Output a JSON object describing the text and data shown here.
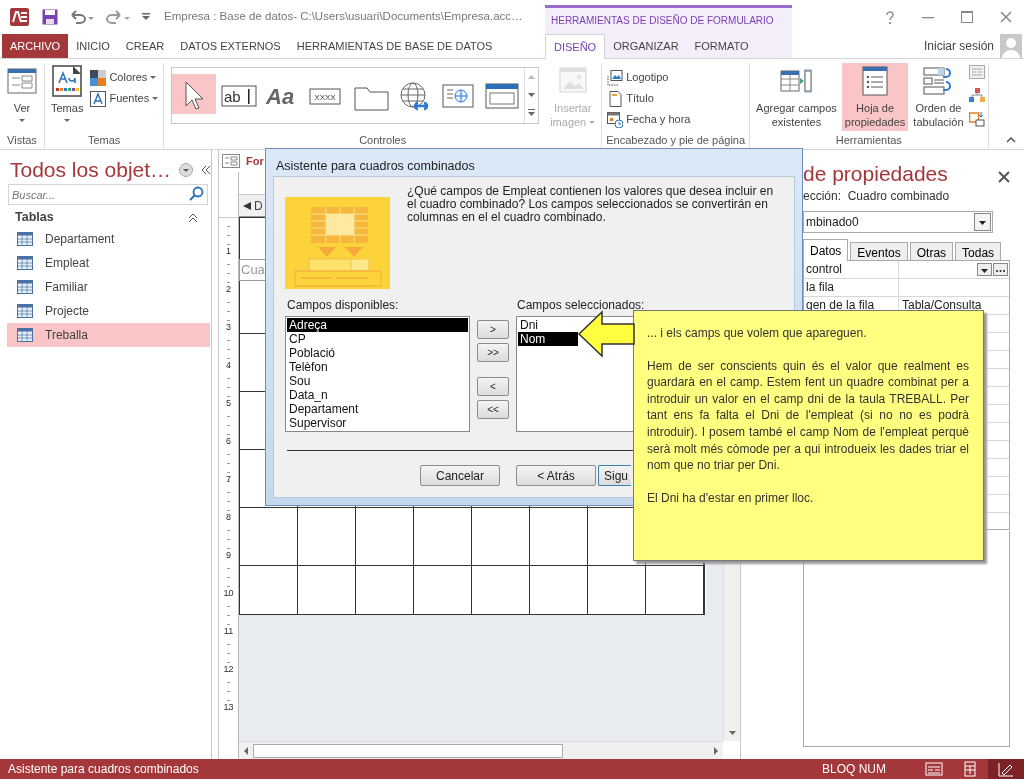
{
  "title_bar": {
    "title": "Empresa : Base de datos- C:\\Users\\usuari\\Documents\\Empresa.acc…",
    "context_tab": "HERRAMIENTAS DE DISEÑO DE FORMULARIO",
    "sign_in": "Iniciar sesión"
  },
  "ribbon_tabs": [
    {
      "label": "ARCHIVO",
      "kind": "file",
      "selected": false
    },
    {
      "label": "INICIO",
      "kind": "tab",
      "selected": false
    },
    {
      "label": "CREAR",
      "kind": "tab",
      "selected": false
    },
    {
      "label": "DATOS EXTERNOS",
      "kind": "tab",
      "selected": false
    },
    {
      "label": "HERRAMIENTAS DE BASE DE DATOS",
      "kind": "tab",
      "selected": false
    },
    {
      "label": "DISEÑO",
      "kind": "context",
      "selected": true
    },
    {
      "label": "ORGANIZAR",
      "kind": "context",
      "selected": false
    },
    {
      "label": "FORMATO",
      "kind": "context",
      "selected": false
    }
  ],
  "ribbon_groups": [
    {
      "label": "Vistas",
      "items": [
        {
          "kind": "large",
          "label": "Ver",
          "menu": true,
          "selected": false,
          "disabled": false
        }
      ]
    },
    {
      "label": "Temas",
      "items": [
        {
          "kind": "large",
          "label": "Temas",
          "menu": true,
          "selected": false,
          "disabled": false
        },
        {
          "kind": "small",
          "label": "Colores",
          "menu": true
        },
        {
          "kind": "small",
          "label": "Fuentes",
          "menu": true
        }
      ]
    },
    {
      "label": "Controles",
      "items": [
        {
          "kind": "gallery",
          "tools": [
            {
              "selected": true
            },
            {
              "glyph": "ab",
              "selected": false
            },
            {
              "glyph": "Aa",
              "selected": false
            },
            {
              "glyph": "XXXX",
              "selected": false
            },
            {
              "selected": false
            },
            {
              "selected": false
            },
            {
              "selected": false
            },
            {
              "selected": false
            }
          ]
        },
        {
          "kind": "large",
          "label": "Insertar\nimagen",
          "menu": true,
          "selected": false,
          "disabled": true
        }
      ]
    },
    {
      "label": "Encabezado y pie de página",
      "items": [
        {
          "kind": "small",
          "label": "Logotipo",
          "menu": false
        },
        {
          "kind": "small",
          "label": "Título",
          "menu": false
        },
        {
          "kind": "small",
          "label": "Fecha y hora",
          "menu": false
        }
      ]
    },
    {
      "label": "Herramientas",
      "items": [
        {
          "kind": "large",
          "label": "Agregar campos\nexistentes",
          "menu": false,
          "selected": false,
          "disabled": false
        },
        {
          "kind": "large",
          "label": "Hoja de\npropiedades",
          "menu": false,
          "selected": true,
          "disabled": false
        },
        {
          "kind": "large",
          "label": "Orden de\ntabulación",
          "menu": false,
          "selected": false,
          "disabled": false
        },
        {
          "kind": "icons"
        }
      ]
    }
  ],
  "navigation": {
    "title": "Todos los objet…",
    "search_placeholder": "Buscar...",
    "groups": [
      {
        "label": "Tablas",
        "expanded": true,
        "items": [
          {
            "label": "Departament",
            "selected": false
          },
          {
            "label": "Empleat",
            "selected": false
          },
          {
            "label": "Familiar",
            "selected": false
          },
          {
            "label": "Projecte",
            "selected": false
          },
          {
            "label": "Treballa",
            "selected": true
          }
        ]
      }
    ]
  },
  "designer": {
    "tab_label": "For",
    "section_header": "D",
    "field_label": "Cua",
    "ruler": [
      "1",
      "2",
      "3",
      "4",
      "5",
      "6",
      "7",
      "8",
      "9",
      "10",
      "11",
      "12",
      "13"
    ]
  },
  "property_sheet": {
    "title": "de propiedades",
    "selection": "ección:  Cuadro combinado",
    "control_name": "mbinado0",
    "tabs": [
      {
        "label": "Datos",
        "selected": true
      },
      {
        "label": "Eventos",
        "selected": false
      },
      {
        "label": "Otras",
        "selected": false
      },
      {
        "label": "Todas",
        "selected": false
      }
    ],
    "rows": [
      {
        "name": "control",
        "kind": "combo"
      },
      {
        "name": "la fila",
        "kind": "text"
      },
      {
        "name": "gen de la fila",
        "value": "Tabla/Consulta",
        "kind": "text"
      }
    ]
  },
  "dialog": {
    "title": "Asistente para cuadros combinados",
    "question": "¿Qué campos de Empleat contienen los valores que desea incluir en el cuadro combinado? Los campos seleccionados se convertirán en columnas en el el cuadro combinado.",
    "available_label": "Campos disponibles:",
    "available_fields": [
      {
        "label": "Adreça",
        "selected": true
      },
      {
        "label": "CP",
        "selected": false
      },
      {
        "label": "Població",
        "selected": false
      },
      {
        "label": "Telèfon",
        "selected": false
      },
      {
        "label": "Sou",
        "selected": false
      },
      {
        "label": "Data_n",
        "selected": false
      },
      {
        "label": "Departament",
        "selected": false
      },
      {
        "label": "Supervisor",
        "selected": false
      }
    ],
    "move_buttons": [
      ">",
      ">>",
      "<",
      "<<"
    ],
    "selected_label": "Campos seleccionados:",
    "selected_fields": [
      {
        "label": "Dni",
        "selected": false
      },
      {
        "label": "Nom",
        "selected": true
      }
    ],
    "buttons": [
      "Cancelar",
      "< Atrás",
      "Sigu"
    ]
  },
  "callout": {
    "paragraphs": [
      "... i els camps que volem que apareguen.",
      "Hem de ser conscients quin és el valor que realment es guardarà en el camp. Estem fent un quadre combinat per a introduir un valor en el camp dni de la taula TREBALL. Per tant ens fa falta el Dni de l'empleat (si no no es podrà introduir). I posem també el camp Nom de l'empleat perquè serà molt més còmode per a qui introdueix les dades triar el nom que no triar per Dni.",
      "El Dni ha d'estar en primer lloc."
    ]
  },
  "status_bar": {
    "text": "Asistente para cuadros combinados",
    "indicator": "BLOQ NUM",
    "views": [
      {
        "selected": false
      },
      {
        "selected": false
      },
      {
        "selected": true
      }
    ]
  }
}
